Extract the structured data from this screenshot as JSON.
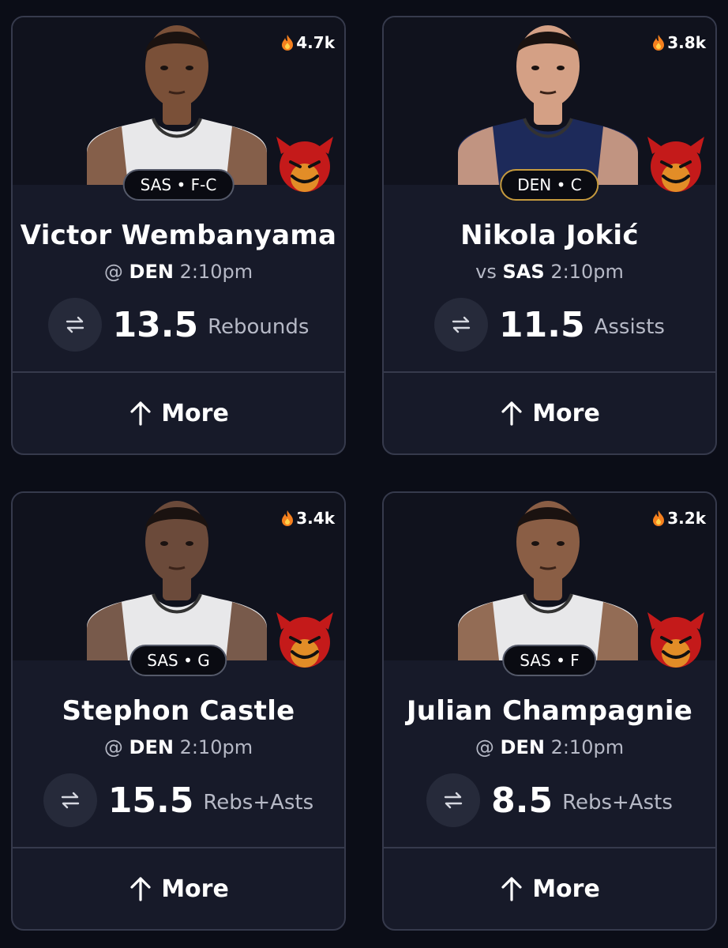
{
  "cards": [
    {
      "heat": "4.7k",
      "badge": "SAS • F-C",
      "badge_style": "default",
      "jersey_color": "#e8e8ea",
      "skin_color": "#7a5038",
      "name": "Victor Wembanyama",
      "matchup_prefix": "@",
      "opponent": "DEN",
      "time": "2:10pm",
      "line": "13.5",
      "stat": "Rebounds",
      "more_label": "More"
    },
    {
      "heat": "3.8k",
      "badge": "DEN • C",
      "badge_style": "gold",
      "jersey_color": "#1d2a5a",
      "skin_color": "#d4a085",
      "name": "Nikola Jokić",
      "matchup_prefix": "vs",
      "opponent": "SAS",
      "time": "2:10pm",
      "line": "11.5",
      "stat": "Assists",
      "more_label": "More"
    },
    {
      "heat": "3.4k",
      "badge": "SAS • G",
      "badge_style": "default",
      "jersey_color": "#e8e8ea",
      "skin_color": "#6b4a3a",
      "name": "Stephon Castle",
      "matchup_prefix": "@",
      "opponent": "DEN",
      "time": "2:10pm",
      "line": "15.5",
      "stat": "Rebs+Asts",
      "more_label": "More"
    },
    {
      "heat": "3.2k",
      "badge": "SAS • F",
      "badge_style": "default",
      "jersey_color": "#e8e8ea",
      "skin_color": "#8a5e45",
      "name": "Julian Champagnie",
      "matchup_prefix": "@",
      "opponent": "DEN",
      "time": "2:10pm",
      "line": "8.5",
      "stat": "Rebs+Asts",
      "more_label": "More"
    }
  ],
  "colors": {
    "background": "#0b0d17",
    "card": "#171a29",
    "card_border": "#363a4c",
    "muted_text": "#b6b9c6",
    "gold_border": "#c59a3e",
    "devil_red": "#c41a1a",
    "flame_orange": "#f5801e"
  },
  "icons": {
    "heat": "flame-icon",
    "swap": "swap-arrows-icon",
    "more": "arrow-up-icon",
    "mascot": "devil-emoji-icon"
  }
}
